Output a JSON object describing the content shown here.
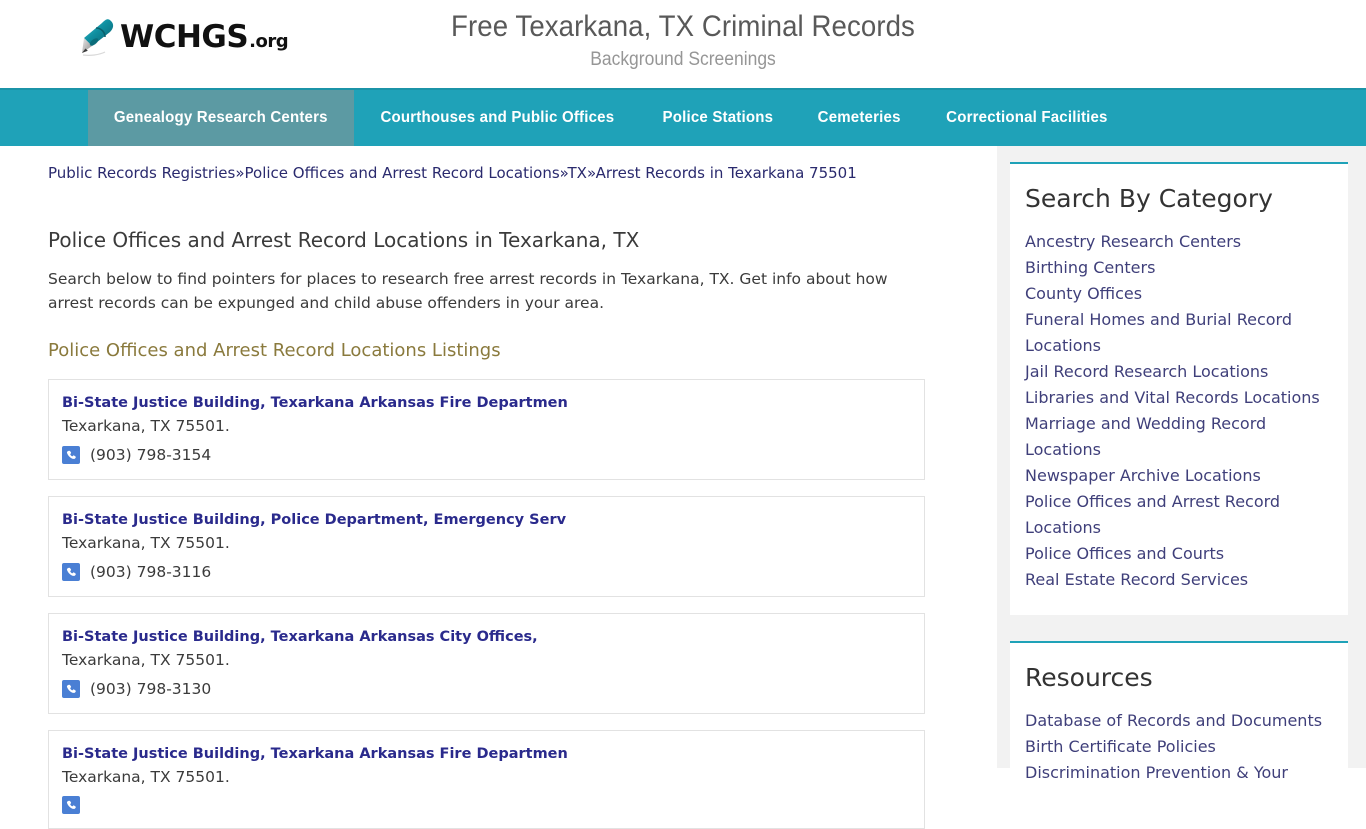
{
  "header": {
    "logo_text": "WCHGS",
    "logo_tld": ".org",
    "logo_icon": "pen-icon",
    "title": "Free Texarkana, TX Criminal Records",
    "subtitle": "Background Screenings"
  },
  "nav": {
    "items": [
      {
        "label": "Genealogy Research Centers",
        "active": true
      },
      {
        "label": "Courthouses and Public Offices",
        "active": false
      },
      {
        "label": "Police Stations",
        "active": false
      },
      {
        "label": "Cemeteries",
        "active": false
      },
      {
        "label": "Correctional Facilities",
        "active": false
      }
    ]
  },
  "breadcrumb": {
    "separator": "»",
    "items": [
      "Public Records Registries",
      "Police Offices and Arrest Record Locations",
      "TX",
      "Arrest Records in Texarkana 75501"
    ]
  },
  "main": {
    "heading": "Police Offices and Arrest Record Locations in Texarkana, TX",
    "intro": "Search below to find pointers for places to research free arrest records in Texarkana, TX. Get info about how arrest records can be expunged and child abuse offenders in your area.",
    "listings_heading": "Police Offices and Arrest Record Locations Listings",
    "listings": [
      {
        "name": "Bi-State Justice Building, Texarkana Arkansas Fire Departmen",
        "address": "Texarkana, TX 75501.",
        "phone": "(903) 798-3154",
        "phone_icon": "phone-icon"
      },
      {
        "name": "Bi-State Justice Building, Police Department, Emergency Serv",
        "address": "Texarkana, TX 75501.",
        "phone": "(903) 798-3116",
        "phone_icon": "phone-icon"
      },
      {
        "name": "Bi-State Justice Building, Texarkana Arkansas City Offices,",
        "address": "Texarkana, TX 75501.",
        "phone": "(903) 798-3130",
        "phone_icon": "phone-icon"
      },
      {
        "name": "Bi-State Justice Building, Texarkana Arkansas Fire Departmen",
        "address": "Texarkana, TX 75501.",
        "phone": "",
        "phone_icon": "phone-icon"
      }
    ]
  },
  "sidebar": {
    "widgets": [
      {
        "title": "Search By Category",
        "links": [
          "Ancestry Research Centers",
          "Birthing Centers",
          "County Offices",
          "Funeral Homes and Burial Record Locations",
          "Jail Record Research Locations",
          "Libraries and Vital Records Locations",
          "Marriage and Wedding Record Locations",
          "Newspaper Archive Locations",
          "Police Offices and Arrest Record Locations",
          "Police Offices and Courts",
          "Real Estate Record Services"
        ]
      },
      {
        "title": "Resources",
        "links": [
          "Database of Records and Documents",
          "Birth Certificate Policies",
          "Discrimination Prevention & Your"
        ]
      }
    ]
  },
  "colors": {
    "nav_teal": "#1fa2b8",
    "nav_active": "#5c9aa3",
    "link_navy": "#3f3f7a",
    "listing_link": "#2a2a8c",
    "heading_olive": "#8a7a3d",
    "phone_icon_blue": "#4a7fd4",
    "sidebar_bg": "#f2f2f2"
  }
}
